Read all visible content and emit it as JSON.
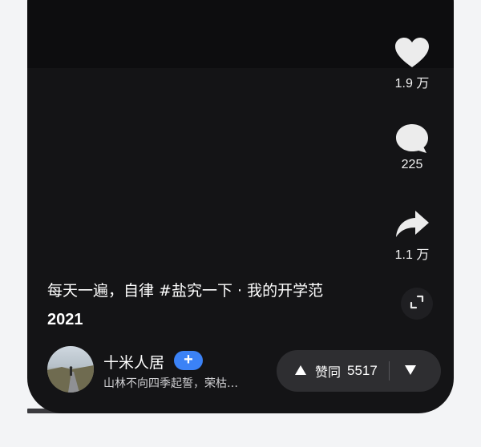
{
  "actions": {
    "like": {
      "icon": "heart-icon",
      "count": "1.9 万"
    },
    "comment": {
      "icon": "comment-bubble-icon",
      "count": "225"
    },
    "share": {
      "icon": "share-arrow-icon",
      "count": "1.1 万"
    },
    "expand": {
      "icon": "expand-corners-icon"
    }
  },
  "caption": {
    "text": "每天一遍，自律 #盐究一下 · 我的开学范",
    "year": "2021"
  },
  "author": {
    "name": "十米人居",
    "follow_label": "+",
    "description": "山林不向四季起誓，荣枯…"
  },
  "vote": {
    "up_label": "赞同",
    "up_count": "5517",
    "up_icon": "triangle-up-icon",
    "down_icon": "triangle-down-icon"
  },
  "colors": {
    "background": "#f3f4f6",
    "phone": "#141416",
    "follow": "#3b82f6",
    "vote_bar": "#2e2e31"
  }
}
